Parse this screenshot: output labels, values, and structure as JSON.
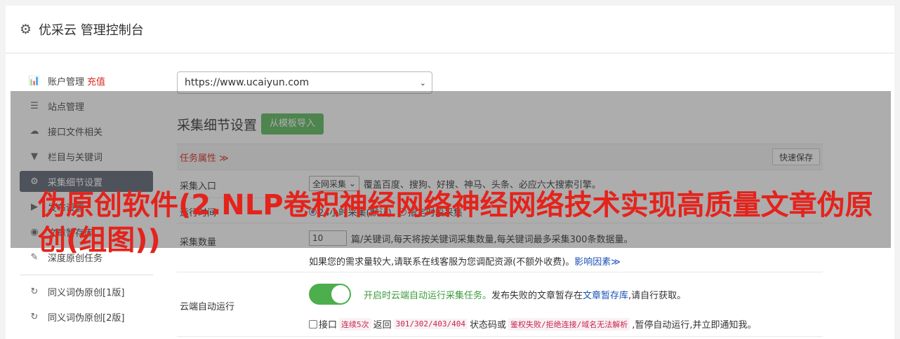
{
  "header": {
    "title": "优采云 管理控制台",
    "icon": "gear-icon"
  },
  "sidebar": {
    "items": [
      {
        "label": "账户管理",
        "badge": "充值",
        "icon": "bar-chart-icon",
        "glyph": "📊"
      },
      {
        "label": "站点管理",
        "icon": "server-icon",
        "glyph": "☰"
      },
      {
        "label": "接口文件相关",
        "icon": "cloud-upload-icon",
        "glyph": "☁"
      },
      {
        "label": "栏目与关键词",
        "icon": "filter-icon",
        "glyph": "▼"
      },
      {
        "label": "采集细节设置",
        "icon": "cogs-icon",
        "glyph": "⚙",
        "active": true
      },
      {
        "label": "发布设置",
        "icon": "play-circle-icon",
        "glyph": "▶"
      },
      {
        "label": "文章暂存库",
        "icon": "database-icon",
        "glyph": "◉"
      },
      {
        "label": "深度原创任务",
        "icon": "edit-icon",
        "glyph": "✎"
      }
    ],
    "items2": [
      {
        "label": "同义词伪原创[1版]",
        "icon": "refresh-icon",
        "glyph": "↻"
      },
      {
        "label": "同义词伪原创[2版]",
        "icon": "refresh-icon",
        "glyph": "↻"
      }
    ]
  },
  "main": {
    "url_select": "https://www.ucaiyun.com",
    "section_title": "采集细节设置",
    "import_button": "从模板导入",
    "task_attr": "任务属性 ≫",
    "quick_save": "快速保存",
    "rows": {
      "entry": {
        "label": "采集入口",
        "select": "全网采集",
        "desc": "覆盖百度、搜狗、好搜、神马、头条、必应六大搜索引擎。"
      },
      "runtime": {
        "label": "运行时间",
        "opt1": "24小时采集(默认)",
        "opt2": "指定时段采集"
      },
      "quantity": {
        "label": "采集数量",
        "value": "10",
        "desc": "篇/关键词,每天将按关键词采集数量,每关键词最多采集300条数据量。",
        "note": "如果您的需求量较大,请联系在线客服为您调配资源(不额外收费)。",
        "note_link": "影响因素≫"
      },
      "cloud": {
        "label": "云端自动运行",
        "enabled_text": "开启时云端自动运行采集任务。",
        "fail_text": "发布失败的文章暂存在",
        "store_link": "文章暂存库",
        "self_fetch": ",请自行获取。",
        "iface": "接口",
        "times": "连续5次",
        "returns": "返回",
        "codes": "301/302/403/404",
        "status_or": "状态码或",
        "auth_fail": "鉴权失败/拒绝连接/域名无法解析",
        "pause": ",暂停自动运行,并立即通知我。"
      }
    }
  },
  "overlay": {
    "text": "伪原创软件(2.NLP卷积神经网络神经网络技术实现高质量文章伪原创(组图))"
  }
}
